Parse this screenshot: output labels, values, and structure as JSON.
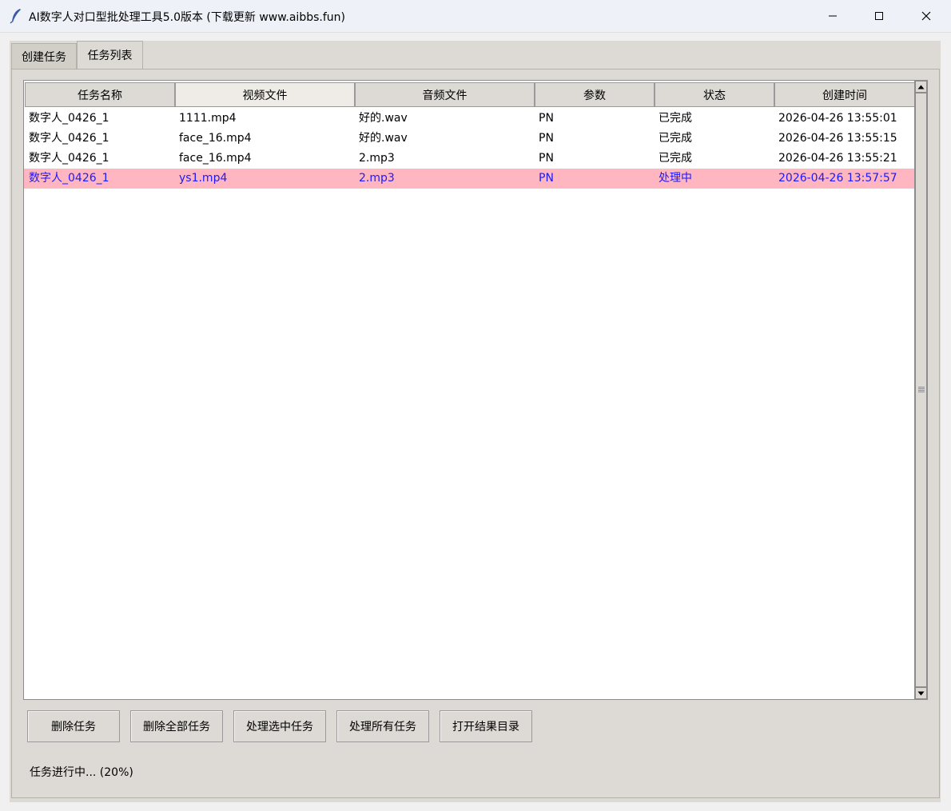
{
  "window": {
    "title": "AI数字人对口型批处理工具5.0版本 (下载更新 www.aibbs.fun)",
    "icon": "feather-icon"
  },
  "tabs": [
    {
      "label": "创建任务",
      "active": false
    },
    {
      "label": "任务列表",
      "active": true
    }
  ],
  "table": {
    "columns": [
      "任务名称",
      "视频文件",
      "音频文件",
      "参数",
      "状态",
      "创建时间"
    ],
    "rows": [
      {
        "name": "数字人_0426_1",
        "video": "1111.mp4",
        "audio": "好的.wav",
        "param": "PN",
        "status": "已完成",
        "created": "2026-04-26 13:55:01",
        "selected": false
      },
      {
        "name": "数字人_0426_1",
        "video": "face_16.mp4",
        "audio": "好的.wav",
        "param": "PN",
        "status": "已完成",
        "created": "2026-04-26 13:55:15",
        "selected": false
      },
      {
        "name": "数字人_0426_1",
        "video": "face_16.mp4",
        "audio": "2.mp3",
        "param": "PN",
        "status": "已完成",
        "created": "2026-04-26 13:55:21",
        "selected": false
      },
      {
        "name": "数字人_0426_1",
        "video": "ys1.mp4",
        "audio": "2.mp3",
        "param": "PN",
        "status": "处理中",
        "created": "2026-04-26 13:57:57",
        "selected": true
      }
    ]
  },
  "buttons": {
    "delete": "删除任务",
    "delete_all": "删除全部任务",
    "process_selected": "处理选中任务",
    "process_all": "处理所有任务",
    "open_results": "打开结果目录"
  },
  "status_text": "任务进行中... (20%)",
  "colors": {
    "selected_row_bg": "#ffb6c1",
    "selected_row_text": "#1a1aff"
  }
}
